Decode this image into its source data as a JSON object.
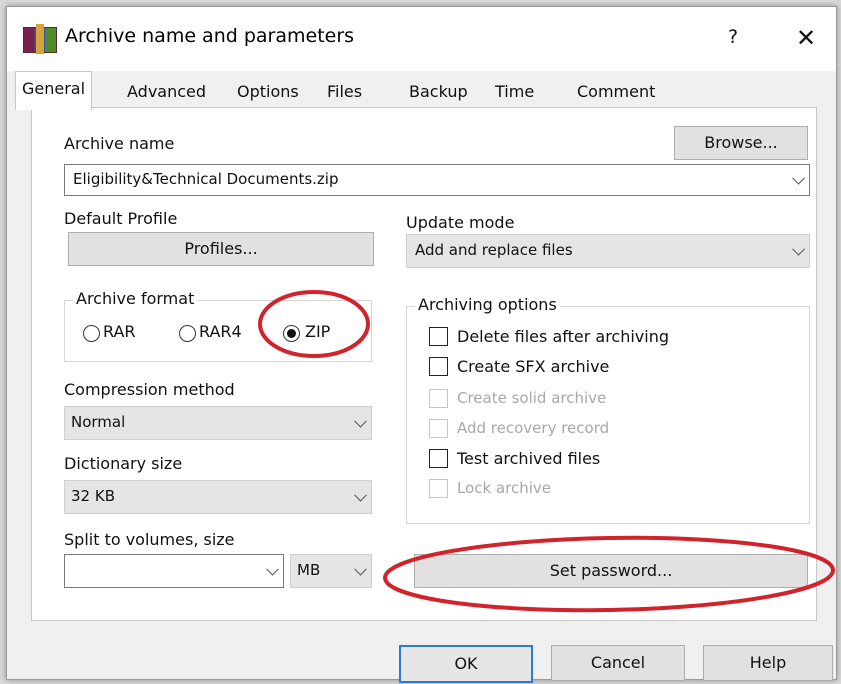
{
  "window": {
    "title": "Archive name and parameters",
    "help": "?",
    "close": "✕"
  },
  "tabs": [
    "General",
    "Advanced",
    "Options",
    "Files",
    "Backup",
    "Time",
    "Comment"
  ],
  "archive_name": {
    "label": "Archive name",
    "browse": "Browse...",
    "value": "Eligibility&Technical Documents.zip"
  },
  "profile": {
    "label": "Default Profile",
    "button": "Profiles..."
  },
  "update": {
    "label": "Update mode",
    "value": "Add and replace files"
  },
  "format": {
    "label": "Archive format",
    "options": [
      "RAR",
      "RAR4",
      "ZIP"
    ],
    "selected": "ZIP"
  },
  "compression": {
    "label": "Compression method",
    "value": "Normal"
  },
  "dictionary": {
    "label": "Dictionary size",
    "value": "32 KB"
  },
  "split": {
    "label": "Split to volumes, size",
    "value": "",
    "unit": "MB"
  },
  "archiving_options": {
    "label": "Archiving options",
    "items": [
      {
        "label": "Delete files after archiving",
        "checked": false,
        "enabled": true
      },
      {
        "label": "Create SFX archive",
        "checked": false,
        "enabled": true
      },
      {
        "label": "Create solid archive",
        "checked": false,
        "enabled": false
      },
      {
        "label": "Add recovery record",
        "checked": false,
        "enabled": false
      },
      {
        "label": "Test archived files",
        "checked": false,
        "enabled": true
      },
      {
        "label": "Lock archive",
        "checked": false,
        "enabled": false
      }
    ]
  },
  "password_button": "Set password...",
  "buttons": {
    "ok": "OK",
    "cancel": "Cancel",
    "help": "Help"
  },
  "colors": {
    "annotation": "#d0232c",
    "default_button_border": "#2a7bd4"
  }
}
